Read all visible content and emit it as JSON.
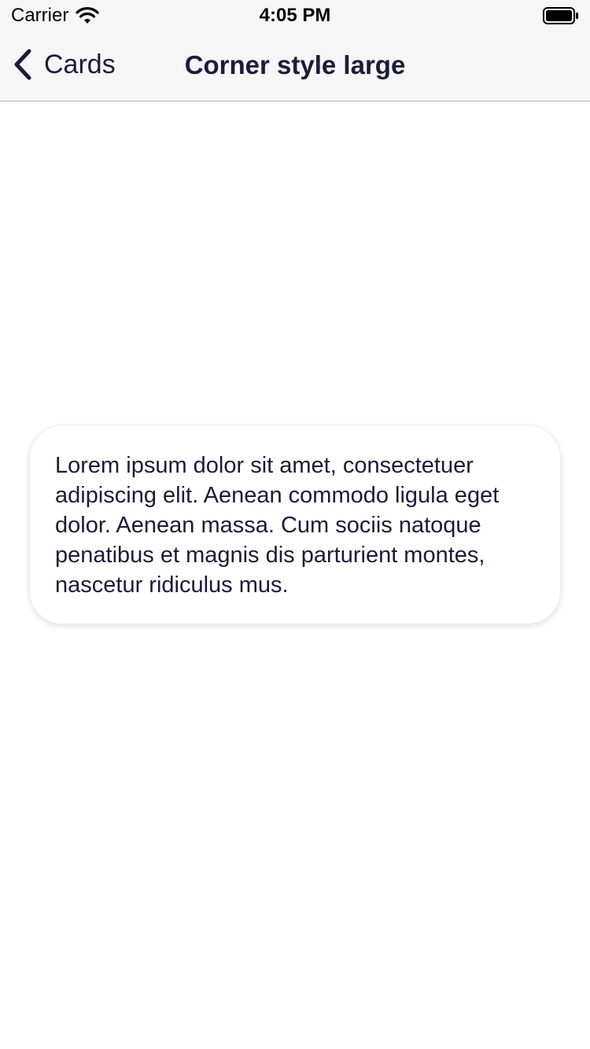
{
  "status_bar": {
    "carrier": "Carrier",
    "time": "4:05 PM",
    "wifi_icon": "wifi-icon",
    "battery_icon": "battery-icon"
  },
  "nav": {
    "back_label": "Cards",
    "back_icon": "chevron-left-icon",
    "title": "Corner style large"
  },
  "card": {
    "text": "Lorem ipsum dolor sit amet, consectetuer adipiscing elit. Aenean commodo ligula eget dolor. Aenean massa. Cum sociis natoque penatibus et magnis dis parturient montes, nascetur ridiculus mus."
  },
  "colors": {
    "text_primary": "#1b1b3a",
    "bar_background": "#f6f6f6",
    "page_background": "#ffffff"
  }
}
